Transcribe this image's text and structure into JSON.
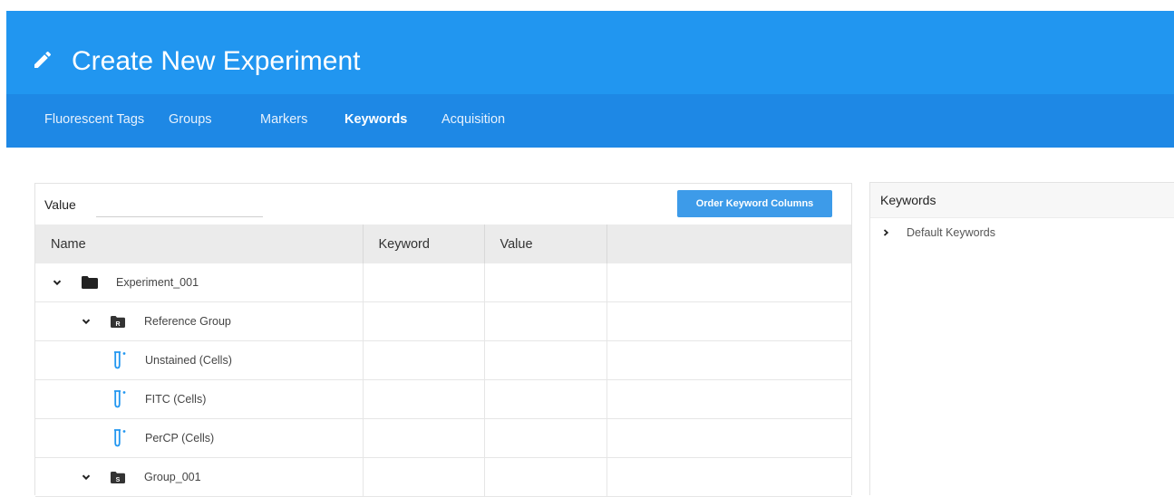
{
  "header": {
    "title": "Create New Experiment",
    "icon": "pencil-icon",
    "color": "#2196f0"
  },
  "tabs": [
    {
      "label": "Fluorescent Tags",
      "active": false
    },
    {
      "label": "Groups",
      "active": false
    },
    {
      "label": "Markers",
      "active": false
    },
    {
      "label": "Keywords",
      "active": true
    },
    {
      "label": "Acquisition",
      "active": false
    }
  ],
  "filter": {
    "label": "Value",
    "input_value": "",
    "placeholder": ""
  },
  "order_button": "Order Keyword Columns",
  "table": {
    "columns": [
      "Name",
      "Keyword",
      "Value",
      ""
    ],
    "rows": [
      {
        "name": "Experiment_001",
        "type": "experiment-folder",
        "expanded": true
      },
      {
        "name": "Reference Group",
        "type": "reference-group-folder",
        "expanded": true,
        "badge": "R"
      },
      {
        "name": "Unstained (Cells)",
        "type": "tube"
      },
      {
        "name": "FITC (Cells)",
        "type": "tube"
      },
      {
        "name": "PerCP (Cells)",
        "type": "tube"
      },
      {
        "name": "Group_001",
        "type": "group-folder",
        "expanded": true,
        "badge": "S"
      }
    ]
  },
  "keywords_panel": {
    "title": "Keywords",
    "items": [
      {
        "label": "Default Keywords",
        "expanded": false
      }
    ]
  }
}
